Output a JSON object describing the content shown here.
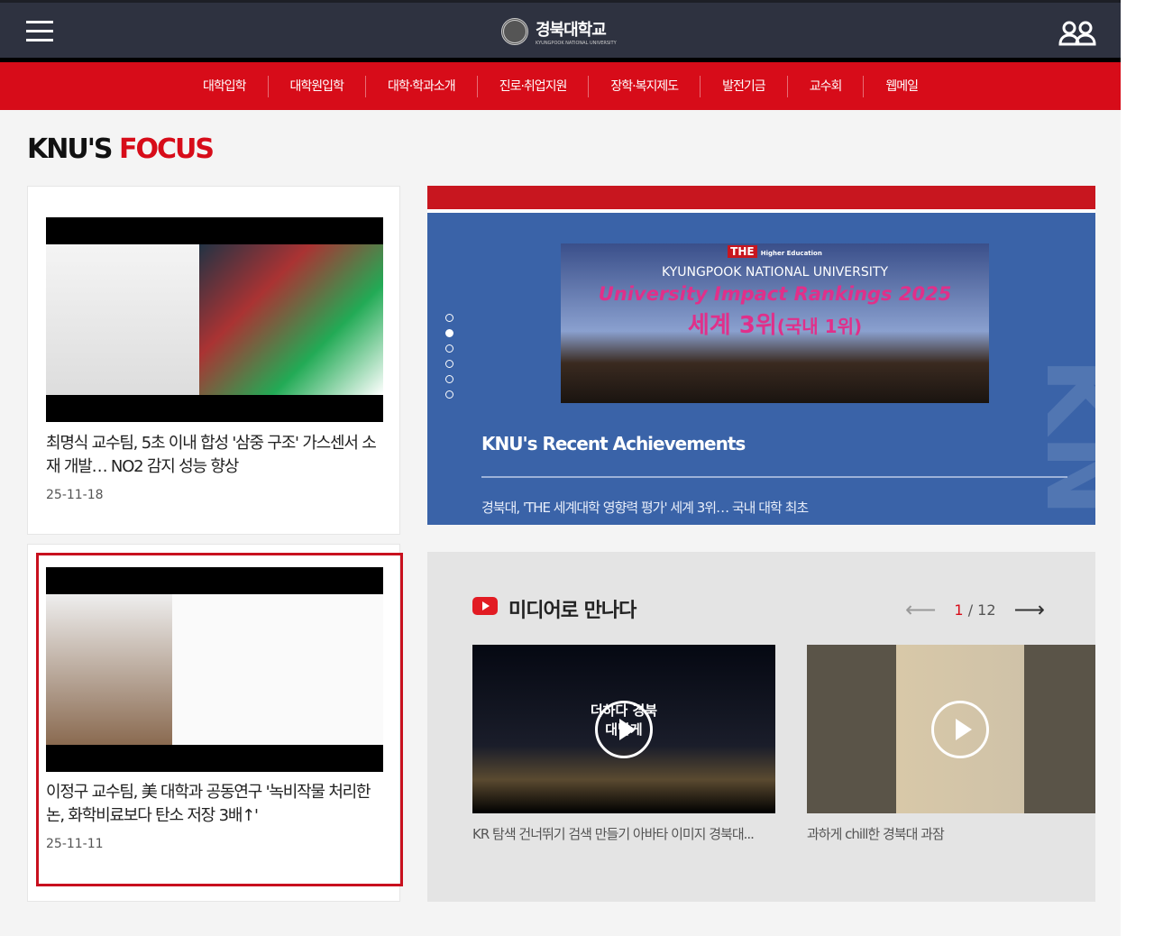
{
  "header": {
    "logo_text": "경북대학교",
    "logo_sub": "KYUNGPOOK NATIONAL UNIVERSITY",
    "menu_icon": "hamburger-icon",
    "user_icon": "users-icon"
  },
  "nav": [
    "대학입학",
    "대학원입학",
    "대학·학과소개",
    "진로·취업지원",
    "장학·복지제도",
    "발전기금",
    "교수회",
    "웹메일"
  ],
  "focus": {
    "title_a": "KNU'S ",
    "title_b": "FOCUS",
    "cards": [
      {
        "title": "최명식 교수팀, 5초 이내 합성 '삼중 구조' 가스센서 소재 개발… NO2 감지 성능 향상",
        "date": "25-11-18"
      },
      {
        "title": "이정구 교수팀, 美 대학과 공동연구 '녹비작물 처리한 논, 화학비료보다 탄소 저장 3배↑'",
        "date": "25-11-11"
      }
    ]
  },
  "banner": {
    "the": "THE",
    "the_sub": "Higher Education",
    "univ": "KYUNGPOOK NATIONAL UNIVERSITY",
    "ranking": "University Impact Rankings 2025",
    "rank": "세계 3위",
    "rank_kr": "(국내 1위)",
    "heading": "KNU's Recent Achievements",
    "summary": "경북대, 'THE 세계대학 영향력 평가' 세계 3위… 국내 대학 최초",
    "slides": 6,
    "active_slide": 2,
    "watermark": "KNU"
  },
  "media": {
    "title": "미디어로 만나다",
    "current": "1",
    "total": "/ 12",
    "videos": [
      {
        "caption": "KR 탐색 건너뛰기 검색 만들기 아바타 이미지 경북대...",
        "overlay": "더하다 경북대답게"
      },
      {
        "caption": "과하게 chill한 경북대 과잠"
      }
    ]
  },
  "colors": {
    "brand_red": "#d70c19",
    "header": "#2e3240",
    "banner_blue": "#3a63a8"
  }
}
